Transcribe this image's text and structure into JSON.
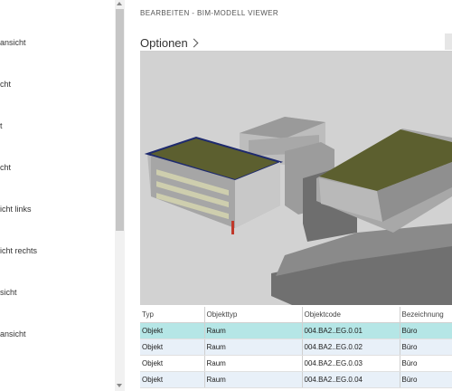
{
  "sidebar": {
    "items": [
      {
        "label": "ansicht"
      },
      {
        "label": "cht"
      },
      {
        "label": "t"
      },
      {
        "label": "cht"
      },
      {
        "label": "icht links"
      },
      {
        "label": "icht rechts"
      },
      {
        "label": "sicht"
      },
      {
        "label": "ansicht"
      }
    ]
  },
  "header": {
    "breadcrumb": "BEARBEITEN - BIM-MODELL VIEWER",
    "options_title": "Optionen"
  },
  "table": {
    "columns": [
      "Typ",
      "Objekttyp",
      "Objektcode",
      "Bezeichnung"
    ],
    "rows": [
      {
        "typ": "Objekt",
        "objekttyp": "Raum",
        "objektcode": "004.BA2..EG.0.01",
        "bezeichnung": "Büro"
      },
      {
        "typ": "Objekt",
        "objekttyp": "Raum",
        "objektcode": "004.BA2..EG.0.02",
        "bezeichnung": "Büro"
      },
      {
        "typ": "Objekt",
        "objekttyp": "Raum",
        "objektcode": "004.BA2..EG.0.03",
        "bezeichnung": "Büro"
      },
      {
        "typ": "Objekt",
        "objekttyp": "Raum",
        "objektcode": "004.BA2..EG.0.04",
        "bezeichnung": "Büro"
      }
    ]
  },
  "colors": {
    "selected_row": "#b5e6e6",
    "alt_row": "#e8f0f8",
    "viewer_bg": "#d2d2d2",
    "roof_green": "#5c5f2f",
    "selection_outline": "#1e2a6e"
  }
}
